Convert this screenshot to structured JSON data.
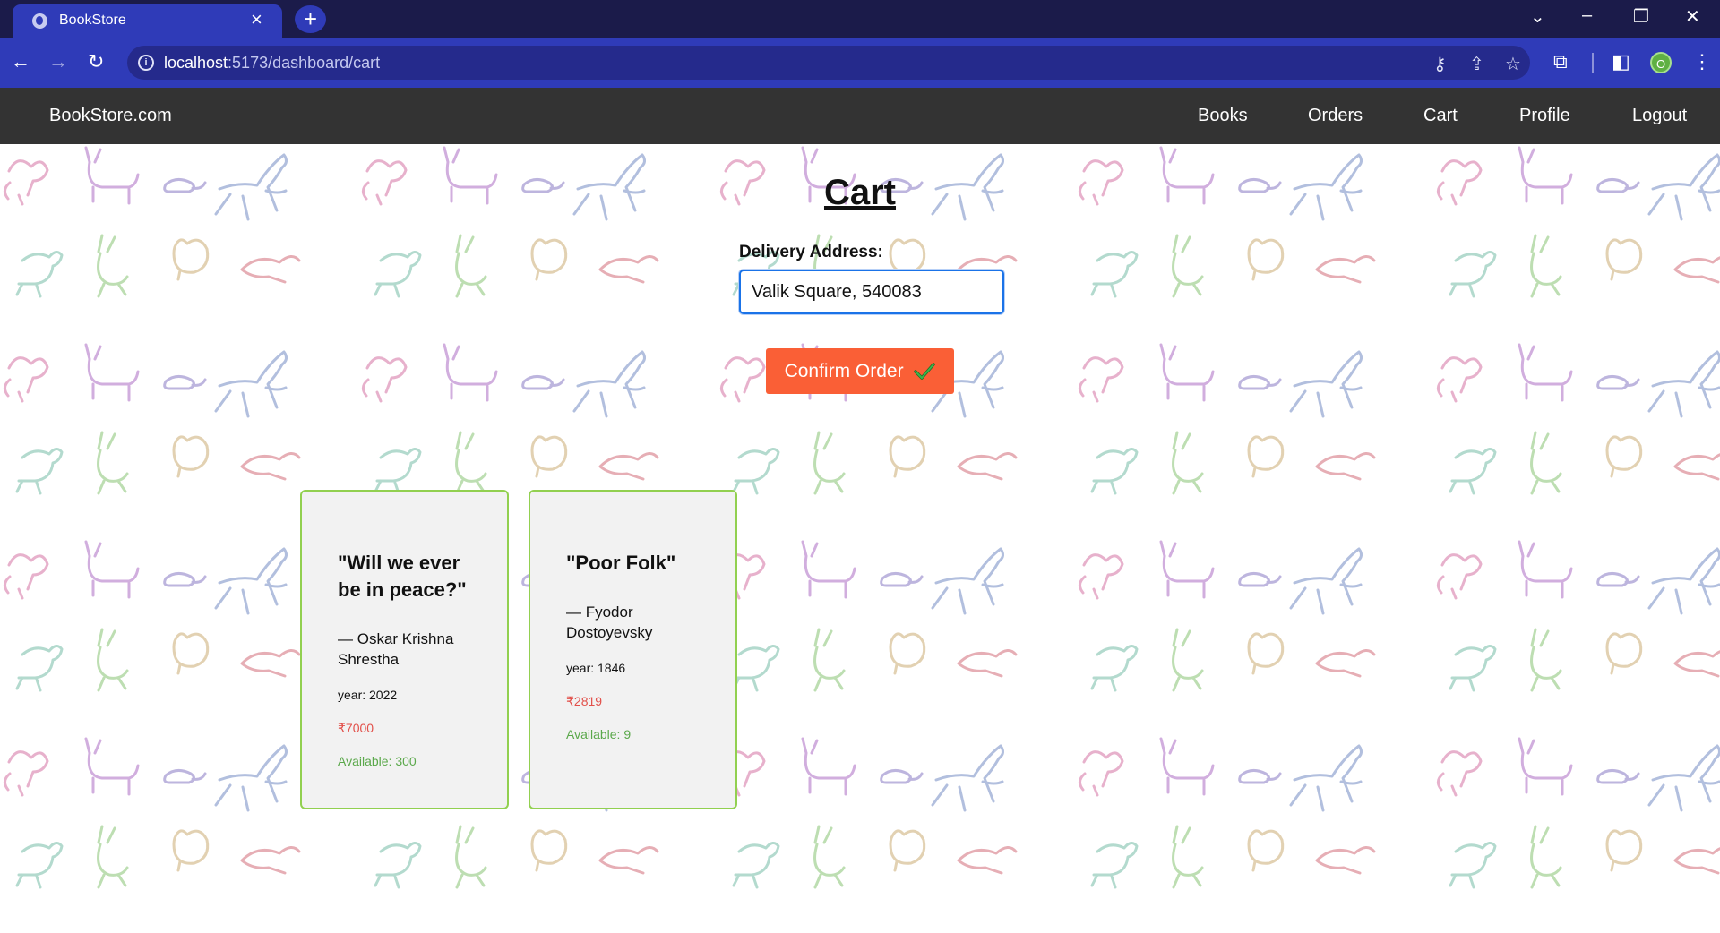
{
  "browser": {
    "tab_title": "BookStore",
    "tab_close": "×",
    "new_tab": "+",
    "url_host": "localhost",
    "url_path": ":5173/dashboard/cart",
    "profile_initial": "O"
  },
  "navbar": {
    "brand": "BookStore.com",
    "links": [
      "Books",
      "Orders",
      "Cart",
      "Profile",
      "Logout"
    ]
  },
  "cart": {
    "title": "Cart",
    "address_label": "Delivery Address:",
    "address_value": "Valik Square, 540083",
    "confirm_label": "Confirm Order"
  },
  "books": [
    {
      "title": "\"Will we ever be in peace?\"",
      "author": "— Oskar Krishna Shrestha",
      "year": "year: 2022",
      "price": "₹7000",
      "available": "Available: 300"
    },
    {
      "title": "\"Poor Folk\"",
      "author": "— Fyodor Dostoyevsky",
      "year": "year: 1846",
      "price": "₹2819",
      "available": "Available: 9"
    }
  ],
  "colors": {
    "tabstrip": "#1b1b4a",
    "toolbar": "#2f3bb8",
    "navbar": "#333333",
    "confirm_button": "#fa5f36",
    "card_border": "#92d050",
    "price": "#e2504a",
    "available": "#5aa84a"
  }
}
